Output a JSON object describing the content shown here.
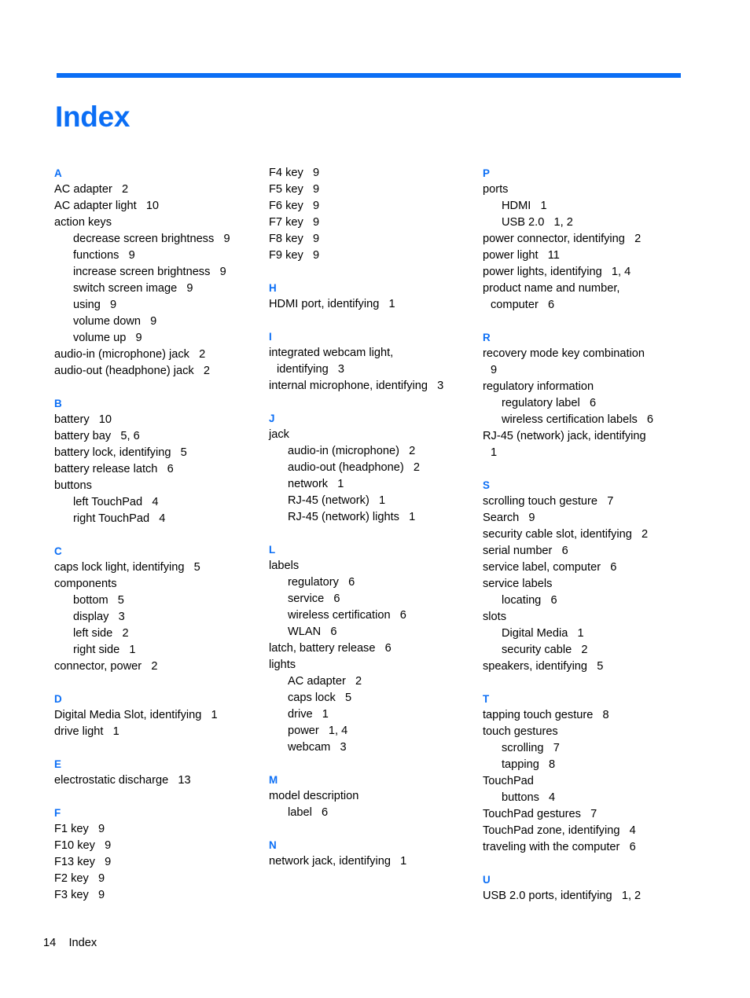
{
  "header": {
    "title": "Index",
    "rule_color": "#0b6ef5",
    "title_color": "#0b6ef5"
  },
  "footer": {
    "page_number": "14",
    "label": "Index",
    "text": "14    Index"
  },
  "columns": [
    {
      "id": "column-1",
      "sections": [
        {
          "letter": "A",
          "entries": [
            {
              "text": "AC adapter",
              "locator": "2",
              "level": 0
            },
            {
              "text": "AC adapter light",
              "locator": "10",
              "level": 0
            },
            {
              "text": "action keys",
              "locator": "",
              "level": 0
            },
            {
              "text": "decrease screen brightness",
              "locator": "9",
              "level": 1
            },
            {
              "text": "functions",
              "locator": "9",
              "level": 1
            },
            {
              "text": "increase screen brightness",
              "locator": "9",
              "level": 1
            },
            {
              "text": "switch screen image",
              "locator": "9",
              "level": 1
            },
            {
              "text": "using",
              "locator": "9",
              "level": 1
            },
            {
              "text": "volume down",
              "locator": "9",
              "level": 1
            },
            {
              "text": "volume up",
              "locator": "9",
              "level": 1
            },
            {
              "text": "audio-in (microphone) jack",
              "locator": "2",
              "level": 0
            },
            {
              "text": "audio-out (headphone) jack",
              "locator": "2",
              "level": 0
            }
          ]
        },
        {
          "letter": "B",
          "entries": [
            {
              "text": "battery",
              "locator": "10",
              "level": 0
            },
            {
              "text": "battery bay",
              "locator": "5, 6",
              "level": 0
            },
            {
              "text": "battery lock, identifying",
              "locator": "5",
              "level": 0
            },
            {
              "text": "battery release latch",
              "locator": "6",
              "level": 0
            },
            {
              "text": "buttons",
              "locator": "",
              "level": 0
            },
            {
              "text": "left TouchPad",
              "locator": "4",
              "level": 1
            },
            {
              "text": "right TouchPad",
              "locator": "4",
              "level": 1
            }
          ]
        },
        {
          "letter": "C",
          "entries": [
            {
              "text": "caps lock light, identifying",
              "locator": "5",
              "level": 0
            },
            {
              "text": "components",
              "locator": "",
              "level": 0
            },
            {
              "text": "bottom",
              "locator": "5",
              "level": 1
            },
            {
              "text": "display",
              "locator": "3",
              "level": 1
            },
            {
              "text": "left side",
              "locator": "2",
              "level": 1
            },
            {
              "text": "right side",
              "locator": "1",
              "level": 1
            },
            {
              "text": "connector, power",
              "locator": "2",
              "level": 0
            }
          ]
        },
        {
          "letter": "D",
          "entries": [
            {
              "text": "Digital Media Slot, identifying",
              "locator": "1",
              "level": 0
            },
            {
              "text": "drive light",
              "locator": "1",
              "level": 0
            }
          ]
        },
        {
          "letter": "E",
          "entries": [
            {
              "text": "electrostatic discharge",
              "locator": "13",
              "level": 0
            }
          ]
        },
        {
          "letter": "F",
          "entries": [
            {
              "text": "F1 key",
              "locator": "9",
              "level": 0
            },
            {
              "text": "F10 key",
              "locator": "9",
              "level": 0
            },
            {
              "text": "F13 key",
              "locator": "9",
              "level": 0
            },
            {
              "text": "F2 key",
              "locator": "9",
              "level": 0
            },
            {
              "text": "F3 key",
              "locator": "9",
              "level": 0
            }
          ]
        }
      ]
    },
    {
      "id": "column-2",
      "sections": [
        {
          "letter": "",
          "entries": [
            {
              "text": "F4 key",
              "locator": "9",
              "level": 0
            },
            {
              "text": "F5 key",
              "locator": "9",
              "level": 0
            },
            {
              "text": "F6 key",
              "locator": "9",
              "level": 0
            },
            {
              "text": "F7 key",
              "locator": "9",
              "level": 0
            },
            {
              "text": "F8 key",
              "locator": "9",
              "level": 0
            },
            {
              "text": "F9 key",
              "locator": "9",
              "level": 0
            }
          ]
        },
        {
          "letter": "H",
          "entries": [
            {
              "text": "HDMI port, identifying",
              "locator": "1",
              "level": 0
            }
          ]
        },
        {
          "letter": "I",
          "entries": [
            {
              "text": "integrated webcam light,",
              "cont": "identifying",
              "locator": "3",
              "level": 0
            },
            {
              "text": "internal microphone, identifying",
              "locator": "3",
              "level": 0
            }
          ]
        },
        {
          "letter": "J",
          "entries": [
            {
              "text": "jack",
              "locator": "",
              "level": 0
            },
            {
              "text": "audio-in (microphone)",
              "locator": "2",
              "level": 1
            },
            {
              "text": "audio-out (headphone)",
              "locator": "2",
              "level": 1
            },
            {
              "text": "network",
              "locator": "1",
              "level": 1
            },
            {
              "text": "RJ-45 (network)",
              "locator": "1",
              "level": 1
            },
            {
              "text": "RJ-45 (network) lights",
              "locator": "1",
              "level": 1
            }
          ]
        },
        {
          "letter": "L",
          "entries": [
            {
              "text": "labels",
              "locator": "",
              "level": 0
            },
            {
              "text": "regulatory",
              "locator": "6",
              "level": 1
            },
            {
              "text": "service",
              "locator": "6",
              "level": 1
            },
            {
              "text": "wireless certification",
              "locator": "6",
              "level": 1
            },
            {
              "text": "WLAN",
              "locator": "6",
              "level": 1
            },
            {
              "text": "latch, battery release",
              "locator": "6",
              "level": 0
            },
            {
              "text": "lights",
              "locator": "",
              "level": 0
            },
            {
              "text": "AC adapter",
              "locator": "2",
              "level": 1
            },
            {
              "text": "caps lock",
              "locator": "5",
              "level": 1
            },
            {
              "text": "drive",
              "locator": "1",
              "level": 1
            },
            {
              "text": "power",
              "locator": "1, 4",
              "level": 1
            },
            {
              "text": "webcam",
              "locator": "3",
              "level": 1
            }
          ]
        },
        {
          "letter": "M",
          "entries": [
            {
              "text": "model description",
              "locator": "",
              "level": 0
            },
            {
              "text": "label",
              "locator": "6",
              "level": 1
            }
          ]
        },
        {
          "letter": "N",
          "entries": [
            {
              "text": "network jack, identifying",
              "locator": "1",
              "level": 0
            }
          ]
        }
      ]
    },
    {
      "id": "column-3",
      "sections": [
        {
          "letter": "P",
          "entries": [
            {
              "text": "ports",
              "locator": "",
              "level": 0
            },
            {
              "text": "HDMI",
              "locator": "1",
              "level": 1
            },
            {
              "text": "USB 2.0",
              "locator": "1, 2",
              "level": 1
            },
            {
              "text": "power connector, identifying",
              "locator": "2",
              "level": 0
            },
            {
              "text": "power light",
              "locator": "11",
              "level": 0
            },
            {
              "text": "power lights, identifying",
              "locator": "1, 4",
              "level": 0
            },
            {
              "text": "product name and number,",
              "cont": "computer",
              "locator": "6",
              "level": 0
            }
          ]
        },
        {
          "letter": "R",
          "entries": [
            {
              "text": "recovery mode key combination",
              "cont": "",
              "locator": "9",
              "level": 0
            },
            {
              "text": "regulatory information",
              "locator": "",
              "level": 0
            },
            {
              "text": "regulatory label",
              "locator": "6",
              "level": 1
            },
            {
              "text": "wireless certification labels",
              "locator": "6",
              "level": 1
            },
            {
              "text": "RJ-45 (network) jack, identifying",
              "cont": "",
              "locator": "1",
              "level": 0
            }
          ]
        },
        {
          "letter": "S",
          "entries": [
            {
              "text": "scrolling touch gesture",
              "locator": "7",
              "level": 0
            },
            {
              "text": "Search",
              "locator": "9",
              "level": 0
            },
            {
              "text": "security cable slot, identifying",
              "locator": "2",
              "level": 0
            },
            {
              "text": "serial number",
              "locator": "6",
              "level": 0
            },
            {
              "text": "service label, computer",
              "locator": "6",
              "level": 0
            },
            {
              "text": "service labels",
              "locator": "",
              "level": 0
            },
            {
              "text": "locating",
              "locator": "6",
              "level": 1
            },
            {
              "text": "slots",
              "locator": "",
              "level": 0
            },
            {
              "text": "Digital Media",
              "locator": "1",
              "level": 1
            },
            {
              "text": "security cable",
              "locator": "2",
              "level": 1
            },
            {
              "text": "speakers, identifying",
              "locator": "5",
              "level": 0
            }
          ]
        },
        {
          "letter": "T",
          "entries": [
            {
              "text": "tapping touch gesture",
              "locator": "8",
              "level": 0
            },
            {
              "text": "touch gestures",
              "locator": "",
              "level": 0
            },
            {
              "text": "scrolling",
              "locator": "7",
              "level": 1
            },
            {
              "text": "tapping",
              "locator": "8",
              "level": 1
            },
            {
              "text": "TouchPad",
              "locator": "",
              "level": 0
            },
            {
              "text": "buttons",
              "locator": "4",
              "level": 1
            },
            {
              "text": "TouchPad gestures",
              "locator": "7",
              "level": 0
            },
            {
              "text": "TouchPad zone, identifying",
              "locator": "4",
              "level": 0
            },
            {
              "text": "traveling with the computer",
              "locator": "6",
              "level": 0
            }
          ]
        },
        {
          "letter": "U",
          "entries": [
            {
              "text": "USB 2.0 ports, identifying",
              "locator": "1, 2",
              "level": 0
            }
          ]
        }
      ]
    }
  ]
}
